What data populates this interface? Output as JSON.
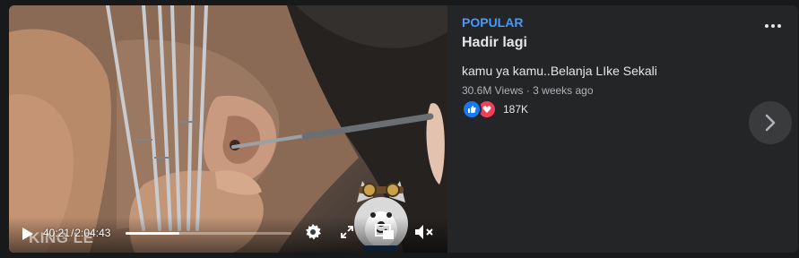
{
  "video": {
    "current_time": "40:21",
    "separator": "/",
    "duration": "2:04:43",
    "progress_fraction": 0.324,
    "watermark": "KING LE"
  },
  "post": {
    "badge": "POPULAR",
    "title": "Hadir lagi",
    "description": "kamu ya kamu..Belanja LIke Sekali",
    "meta": "30.6M Views · 3 weeks ago",
    "reaction_count": "187K"
  },
  "icons": {
    "play": "play-icon",
    "settings": "gear-icon",
    "fullscreen": "fullscreen-icon",
    "pip": "picture-in-picture-icon",
    "volume": "volume-muted-icon",
    "like": "like-icon",
    "love": "love-icon",
    "more": "more-dots-icon",
    "next": "chevron-right-icon"
  },
  "colors": {
    "accent": "#4599ff",
    "like": "#1877f2",
    "love": "#f33e58",
    "card_bg": "#242526",
    "page_bg": "#18191a"
  }
}
